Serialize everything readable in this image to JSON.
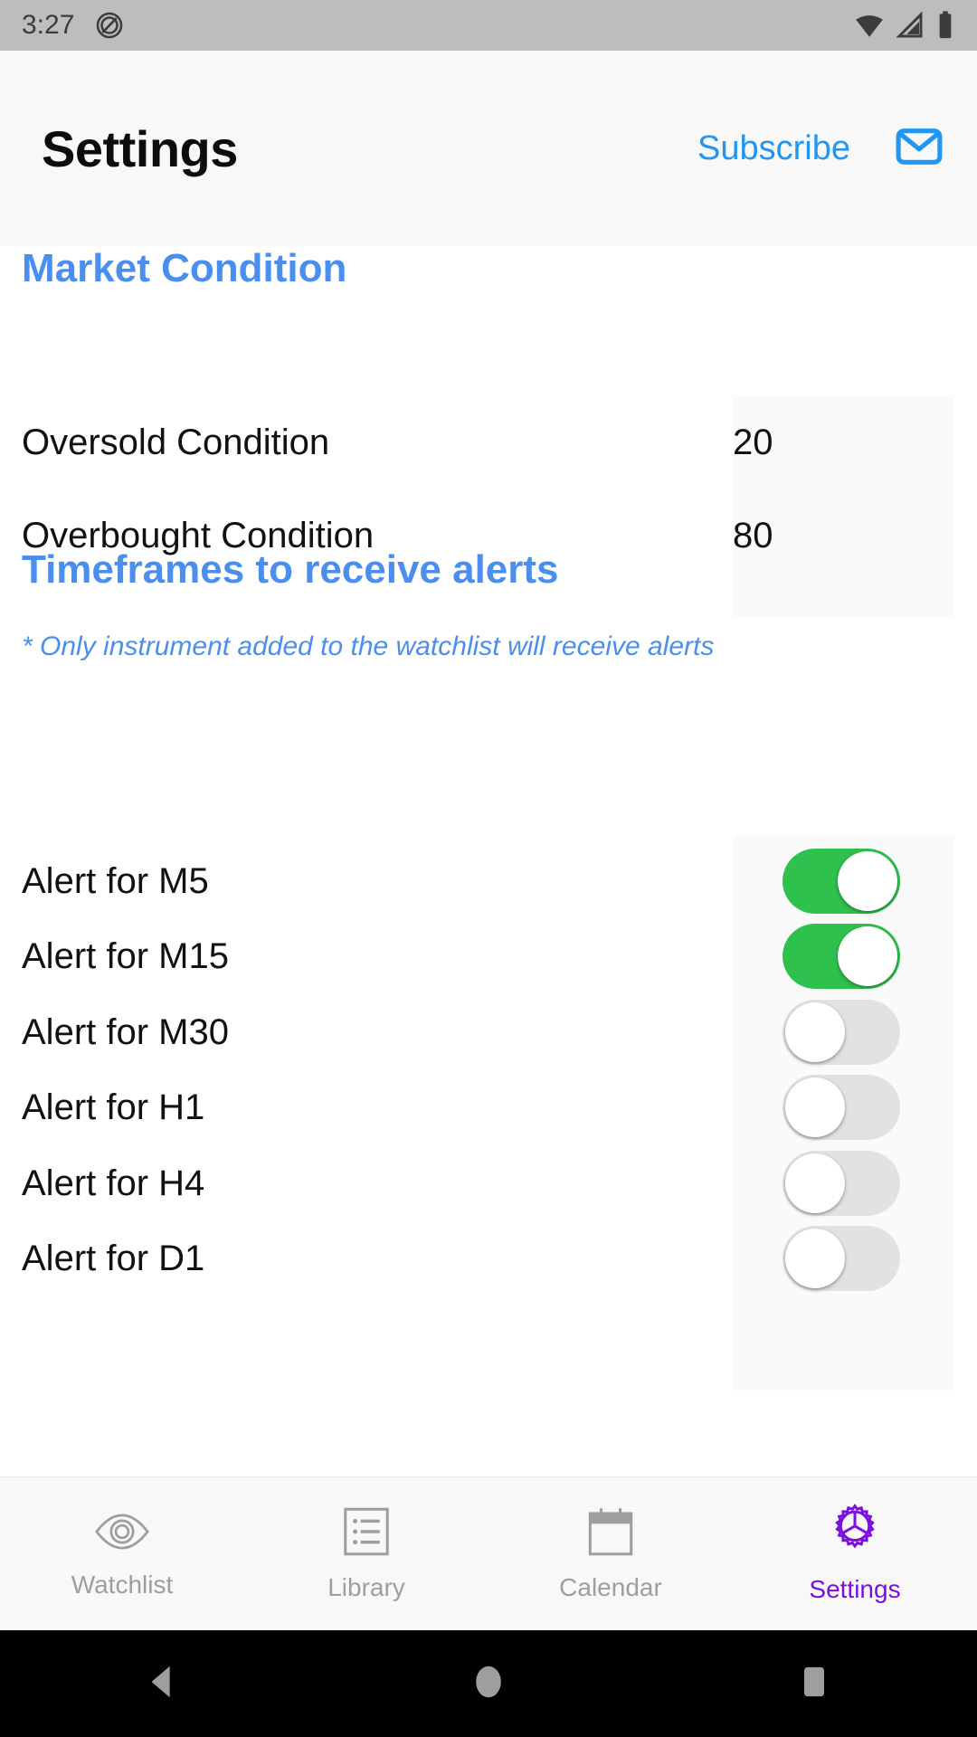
{
  "status_bar": {
    "time": "3:27",
    "icons": [
      "do-not-disturb-icon",
      "wifi-icon",
      "cellular-signal-icon",
      "battery-icon"
    ]
  },
  "app_bar": {
    "title": "Settings",
    "subscribe_label": "Subscribe",
    "mail_icon": "mail-icon",
    "accent_color": "#2196f3"
  },
  "sections": {
    "market_condition": {
      "title": "Market Condition",
      "title_color": "#4a8ff0",
      "rows": [
        {
          "label": "Oversold Condition",
          "value": "20"
        },
        {
          "label": "Overbought Condition",
          "value": "80"
        }
      ]
    },
    "timeframes": {
      "title": "Timeframes to receive alerts",
      "note": "* Only instrument added to the watchlist will receive alerts",
      "title_color": "#4a8ff0",
      "toggle_on_color": "#2ec14e",
      "toggle_off_color": "#e2e2e2",
      "rows": [
        {
          "label": "Alert for M5",
          "state": "on"
        },
        {
          "label": "Alert for M15",
          "state": "on"
        },
        {
          "label": "Alert for M30",
          "state": "off"
        },
        {
          "label": "Alert for H1",
          "state": "off"
        },
        {
          "label": "Alert for H4",
          "state": "off"
        },
        {
          "label": "Alert for D1",
          "state": "off"
        }
      ]
    }
  },
  "tab_bar": {
    "active_color": "#7b0fe0",
    "inactive_color": "#9e9e9e",
    "tabs": [
      {
        "label": "Watchlist",
        "icon": "eye-icon",
        "active": false
      },
      {
        "label": "Library",
        "icon": "list-icon",
        "active": false
      },
      {
        "label": "Calendar",
        "icon": "calendar-icon",
        "active": false
      },
      {
        "label": "Settings",
        "icon": "gear-icon",
        "active": true
      }
    ]
  },
  "nav_bar": {
    "buttons": [
      "back-icon",
      "home-icon",
      "recents-icon"
    ]
  }
}
